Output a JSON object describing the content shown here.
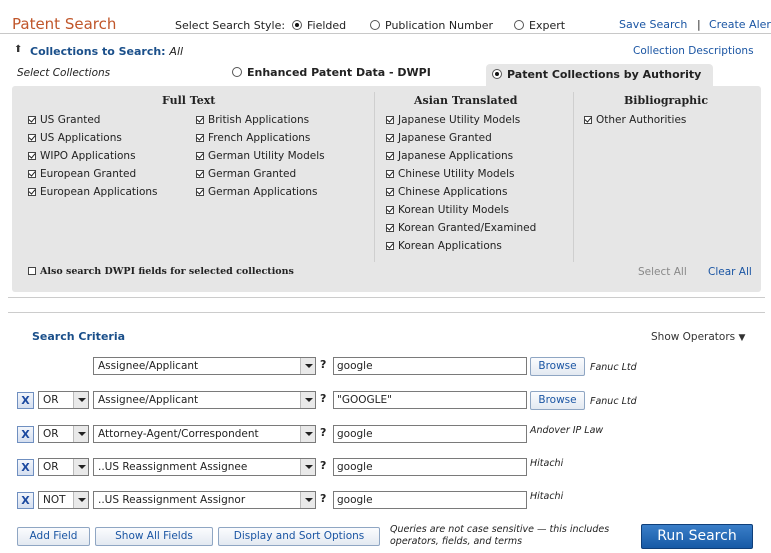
{
  "header": {
    "title": "Patent Search",
    "style_label": "Select Search Style:",
    "styles": [
      {
        "label": "Fielded",
        "selected": true
      },
      {
        "label": "Publication Number",
        "selected": false
      },
      {
        "label": "Expert",
        "selected": false
      }
    ],
    "save_search": "Save Search",
    "separator": "|",
    "create_alert": "Create Aler"
  },
  "collections": {
    "heading": "Collections to Search:",
    "heading_value": "All",
    "descriptions_link": "Collection Descriptions",
    "select_label": "Select Collections",
    "tabs": [
      {
        "label": "Enhanced Patent Data - DWPI",
        "selected": false
      },
      {
        "label": "Patent Collections by Authority",
        "selected": true
      }
    ],
    "groups": {
      "full_text": {
        "title": "Full Text",
        "col1": [
          "US Granted",
          "US Applications",
          "WIPO Applications",
          "European Granted",
          "European Applications"
        ],
        "col2": [
          "British Applications",
          "French Applications",
          "German Utility Models",
          "German Granted",
          "German Applications"
        ]
      },
      "asian": {
        "title": "Asian Translated",
        "items": [
          "Japanese Utility Models",
          "Japanese Granted",
          "Japanese Applications",
          "Chinese Utility Models",
          "Chinese Applications",
          "Korean Utility Models",
          "Korean Granted/Examined",
          "Korean Applications"
        ]
      },
      "bibliographic": {
        "title": "Bibliographic",
        "items": [
          "Other Authorities"
        ]
      }
    },
    "dwpi_checkbox": "Also search DWPI fields for selected collections",
    "select_all": "Select All",
    "clear_all": "Clear All"
  },
  "criteria": {
    "heading": "Search Criteria",
    "show_operators": "Show Operators",
    "rows": [
      {
        "operator": "",
        "field": "Assignee/Applicant",
        "value": "google",
        "browse": "Browse",
        "hint": "Fanuc Ltd"
      },
      {
        "operator": "OR",
        "field": "Assignee/Applicant",
        "value": "\"GOOGLE\"",
        "browse": "Browse",
        "hint": "Fanuc Ltd"
      },
      {
        "operator": "OR",
        "field": "Attorney-Agent/Correspondent",
        "value": "google",
        "browse": "",
        "hint": "Andover IP Law"
      },
      {
        "operator": "OR",
        "field": "..US Reassignment Assignee",
        "value": "google",
        "browse": "",
        "hint": "Hitachi"
      },
      {
        "operator": "NOT",
        "field": "..US Reassignment Assignor",
        "value": "google",
        "browse": "",
        "hint": "Hitachi"
      }
    ],
    "buttons": {
      "add_field": "Add Field",
      "show_all": "Show All Fields",
      "display_sort": "Display and Sort Options"
    },
    "note_line1": "Queries are not case sensitive — this includes",
    "note_line2": "operators, fields, and terms",
    "run_search": "Run Search",
    "help_mark": "?",
    "remove_mark": "X"
  }
}
